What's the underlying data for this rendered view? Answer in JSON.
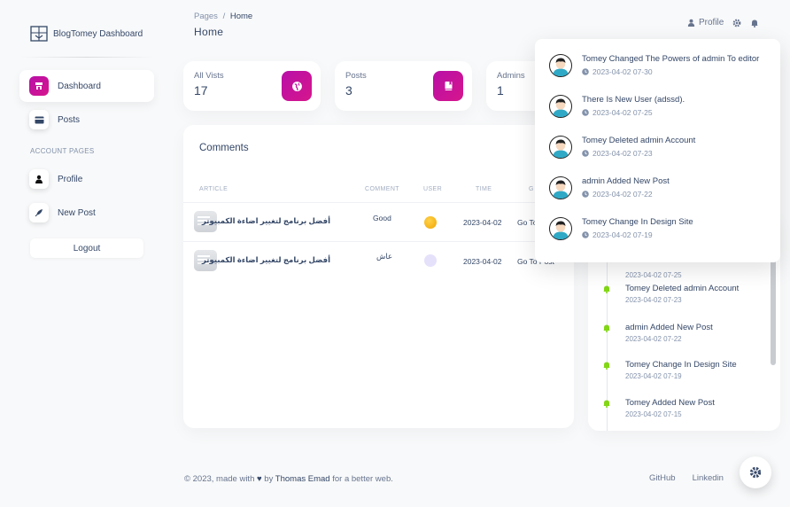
{
  "brand": {
    "name": "BlogTomey Dashboard"
  },
  "sidebar": {
    "items": [
      {
        "label": "Dashboard",
        "icon": "store-icon"
      },
      {
        "label": "Posts",
        "icon": "card-icon"
      }
    ],
    "section_label": "ACCOUNT PAGES",
    "account_items": [
      {
        "label": "Profile",
        "icon": "user-icon"
      },
      {
        "label": "New Post",
        "icon": "rocket-icon"
      }
    ],
    "logout_label": "Logout"
  },
  "header": {
    "breadcrumb_root": "Pages",
    "breadcrumb_sep": "/",
    "breadcrumb_current": "Home",
    "title": "Home",
    "profile_label": "Profile"
  },
  "stats": [
    {
      "label": "All Vists",
      "value": "17",
      "icon": "globe-icon"
    },
    {
      "label": "Posts",
      "value": "3",
      "icon": "book-icon"
    },
    {
      "label": "Admins",
      "value": "1"
    }
  ],
  "comments": {
    "title": "Comments",
    "columns": [
      "ARTICLE",
      "COMMENT",
      "USER",
      "TIME",
      "G"
    ],
    "rows": [
      {
        "article": "أفضل برنامج لتغيير اضاءة الكمبيوتر",
        "comment": "Good",
        "time": "2023-04-02",
        "action": "Go To"
      },
      {
        "article": "أفضل برنامج لتغيير اضاءة الكمبيوتر",
        "comment": "عاش",
        "time": "2023-04-02",
        "action": "Go To Post"
      }
    ]
  },
  "timeline": [
    {
      "text": "",
      "time": "2023-04-02 07-25"
    },
    {
      "text": "Tomey Deleted admin Account",
      "time": "2023-04-02 07-23"
    },
    {
      "text": "admin Added New Post",
      "time": "2023-04-02 07-22"
    },
    {
      "text": "Tomey Change In Design Site",
      "time": "2023-04-02 07-19"
    },
    {
      "text": "Tomey Added New Post",
      "time": "2023-04-02 07-15"
    }
  ],
  "notifications": [
    {
      "text": "Tomey Changed The Powers of admin To editor",
      "time": "2023-04-02 07-30"
    },
    {
      "text": "There Is New User (adssd).",
      "time": "2023-04-02 07-25"
    },
    {
      "text": "Tomey Deleted admin Account",
      "time": "2023-04-02 07-23"
    },
    {
      "text": "admin Added New Post",
      "time": "2023-04-02 07-22"
    },
    {
      "text": "Tomey Change In Design Site",
      "time": "2023-04-02 07-19"
    }
  ],
  "footer": {
    "prefix": "© 2023, made with",
    "by": "by",
    "author": "Thomas Emad",
    "suffix": "for a better web.",
    "links": [
      "GitHub",
      "Linkedin"
    ]
  },
  "colors": {
    "accent": "#c0149f",
    "text": "#344767",
    "muted": "#8392ab",
    "bell_green": "#82d616"
  }
}
